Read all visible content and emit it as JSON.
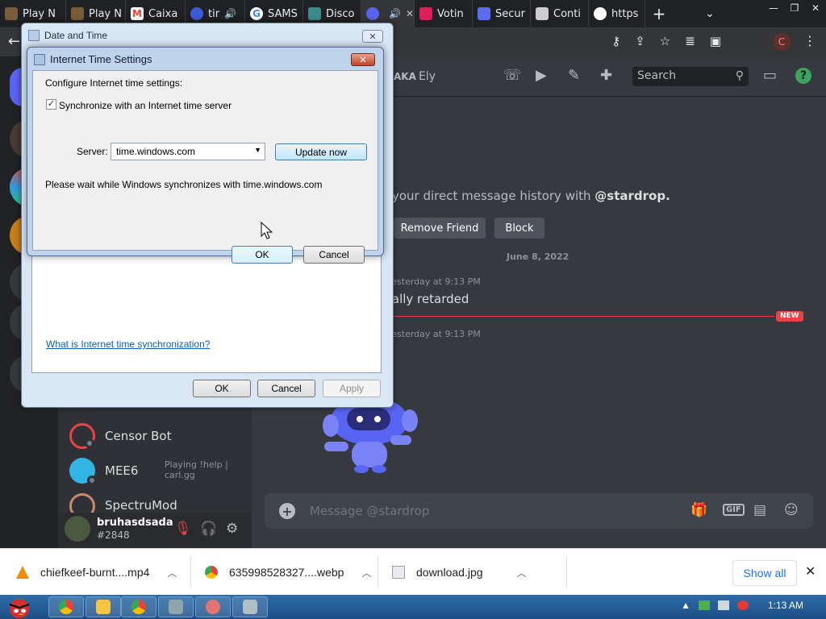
{
  "browser": {
    "tabs": [
      {
        "label": "Play N",
        "icon": "play-store-icon",
        "color": "#7a5c3b"
      },
      {
        "label": "Play N",
        "icon": "play-store-icon",
        "color": "#7a5c3b"
      },
      {
        "label": "Caixa",
        "icon": "gmail-icon",
        "color": "#ea4335"
      },
      {
        "label": "tir",
        "icon": "tinder-icon",
        "color": "#3b5bdb"
      },
      {
        "label": "SAMS",
        "icon": "google-icon",
        "color": "#ffffff"
      },
      {
        "label": "Disco",
        "icon": "discord-icon",
        "color": "#3c8c8c"
      },
      {
        "label": "",
        "icon": "discord-icon",
        "color": "#5865f2"
      },
      {
        "label": "Votin",
        "icon": "voting-icon",
        "color": "#e01e5a"
      },
      {
        "label": "Secur",
        "icon": "shield-icon",
        "color": "#5b6cf0"
      },
      {
        "label": "Conti",
        "icon": "continue-icon",
        "color": "#cccccc"
      },
      {
        "label": "https",
        "icon": "globe-icon",
        "color": "#ffffff"
      }
    ],
    "new_tab": "+",
    "tab_dropdown": "⌄",
    "win_minimize": "—",
    "win_restore": "❐",
    "win_close": "✕",
    "back": "←",
    "profile_initial": "C",
    "accent": "#35363a"
  },
  "discord": {
    "header": {
      "aka": "AKA",
      "aka_name": "Ely",
      "search_placeholder": "Search",
      "help": "?"
    },
    "dm_list": [
      {
        "name": "Censor Bot",
        "color": "#2f3136"
      },
      {
        "name": "MEE6",
        "color": "#32b5e5"
      },
      {
        "name": "SpectruMod",
        "color": "#2f3136"
      }
    ],
    "activity_text": "Playing !help | carl.gg",
    "user": {
      "name": "bruhasdsada",
      "tag": "#2848"
    },
    "chat": {
      "history_text": "your direct message history with",
      "history_user": "@stardrop.",
      "remove_friend": "Remove Friend",
      "block": "Block",
      "date_divider": "June 8, 2022",
      "timestamp1": "Yesterday at 9:13 PM",
      "message1": "tally retarded",
      "new_badge": "NEW",
      "timestamp2": "Yesterday at 9:13 PM",
      "input_placeholder": "Message @stardrop",
      "gif": "GIF"
    }
  },
  "date_time_dialog": {
    "title": "Date and Time",
    "close": "✕",
    "link": "What is Internet time synchronization?",
    "ok": "OK",
    "cancel": "Cancel",
    "apply": "Apply"
  },
  "internet_time_dialog": {
    "title": "Internet Time Settings",
    "close": "✕",
    "configure_label": "Configure Internet time settings:",
    "sync_checkbox_label": "Synchronize with an Internet time server",
    "sync_checked": true,
    "check_mark": "✓",
    "server_label": "Server:",
    "server_value": "time.windows.com",
    "update_now": "Update now",
    "status": "Please wait while Windows synchronizes with time.windows.com",
    "ok": "OK",
    "cancel": "Cancel"
  },
  "downloads": {
    "items": [
      {
        "name": "chiefkeef-burnt....mp4",
        "icon": "vlc-icon",
        "color": "#f28b0c"
      },
      {
        "name": "635998528327....webp",
        "icon": "chrome-icon",
        "color": "#4285f4"
      },
      {
        "name": "download.jpg",
        "icon": "image-file-icon",
        "color": "#9aa0a6"
      }
    ],
    "show_all": "Show all",
    "close": "✕"
  },
  "taskbar": {
    "time": "1:13 AM",
    "apps": [
      {
        "icon": "chrome-icon",
        "color": "#4caf50"
      },
      {
        "icon": "folder-icon",
        "color": "#f4c542"
      },
      {
        "icon": "chrome-icon",
        "color": "#e53935"
      },
      {
        "icon": "screen-icon",
        "color": "#90a4ae"
      },
      {
        "icon": "snipping-tool-icon",
        "color": "#e57373"
      },
      {
        "icon": "date-time-icon",
        "color": "#b0bec5"
      }
    ]
  }
}
